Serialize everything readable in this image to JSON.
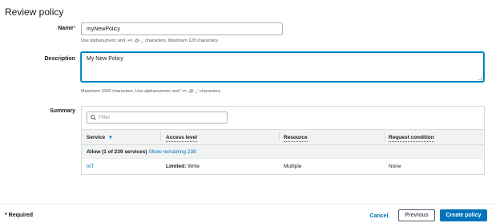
{
  "page": {
    "title": "Review policy"
  },
  "name_field": {
    "label": "Name",
    "required_mark": "*",
    "value": "myNewPolicy",
    "hint": "Use alphanumeric and '+=,.@-_' characters. Maximum 128 characters."
  },
  "description_field": {
    "label": "Description",
    "value": "My New Policy",
    "hint": "Maximum 1000 characters. Use alphanumeric and '+=,.@-_' characters."
  },
  "summary": {
    "label": "Summary",
    "filter_placeholder": "Filter",
    "columns": [
      "Service",
      "Access level",
      "Resource",
      "Request condition"
    ],
    "group_label": "Allow (1 of 239 services)",
    "group_link": "Show remaining 238",
    "rows": [
      {
        "service": "IoT",
        "access_level_bold": "Limited:",
        "access_level_rest": " Write",
        "resource": "Multiple",
        "request_condition": "None"
      }
    ]
  },
  "footer": {
    "required_note": "* Required",
    "cancel_label": "Cancel",
    "previous_label": "Previous",
    "create_label": "Create policy"
  },
  "colors": {
    "accent": "#0073bb",
    "header_bg": "#f2f3f3",
    "border": "#d5dbdb"
  }
}
